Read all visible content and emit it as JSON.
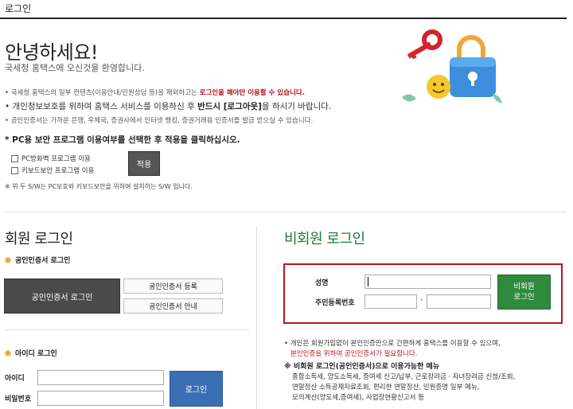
{
  "header": {
    "title": "로그인"
  },
  "greeting": {
    "title": "안녕하세요!",
    "subtitle": "국세청 홈택스에 오신것을 환영합니다."
  },
  "notices": [
    {
      "prefix": "• 국세청 홈택스의 일부 컨텐츠(이용안내/민원상담 등)을 제외하고는 ",
      "highlight": "로그인을 해야만 이용할 수 있습니다."
    },
    {
      "prefix": "• 개인정보보호를 위하여 홈택스 서비스를 이용하신 후 ",
      "strong": "반드시 [로그아웃]",
      "suffix": "을 하시기 바랍니다."
    },
    {
      "prefix": "• 공인인증서는 가까운 은행, 우체국, 증권사에서 인터넷 뱅킹, 증권거래용 인증서를 발급 받으실 수 있습니다."
    }
  ],
  "pc_security": {
    "title": "* PC용 보안 프로그램 이용여부를 선택한 후 적용을 클릭하십시오.",
    "options": [
      "PC방화벽 프로그램 이용",
      "키보드보안 프로그램 이용"
    ],
    "apply_label": "적용",
    "note": "※ 위 두 S/W는 PC보호와 키보드보안을 위하여 설치하는 S/W 입니다."
  },
  "member_login": {
    "title": "회원 로그인",
    "cert_section": "공인인증서 로그인",
    "cert_login_label": "공인인증서 로그인",
    "cert_register_label": "공인인증서 등록",
    "cert_guide_label": "공인인증서 안내",
    "id_section": "아이디 로그인",
    "id_label": "아이디",
    "pw_label": "비밀번호",
    "login_label": "로그인"
  },
  "guest_login": {
    "title": "비회원 로그인",
    "name_label": "성명",
    "rrn_label": "주민등록번호",
    "rrn_sep": "-",
    "button_label": "비회원\n로그인",
    "notes": {
      "line1": "• 개인은 회원가입없이 본인인증만으로 간편하게 홈택스를 이용할 수 있으며,",
      "line2": "본인인증을 위하여 공인인증서가 필요합니다.",
      "services_head": "※ 비회원 로그인(공인인증서)으로 이용가능한 메뉴",
      "services": [
        "종합소득세, 양도소득세, 증여세 신고/납부, 근로장려금ㆍ자녀장려금 신청/조회,",
        "연말정산 소득공제자료조회, 편리한 연말정산, 민원증명 일부 메뉴,",
        "모의계산(양도세,증여세), 사업장현황신고서 등"
      ]
    }
  },
  "colors": {
    "accent_red": "#c1121f",
    "guest_green": "#2f8a3e",
    "login_blue": "#3a6fb5",
    "cert_dark": "#4a4a4a"
  }
}
